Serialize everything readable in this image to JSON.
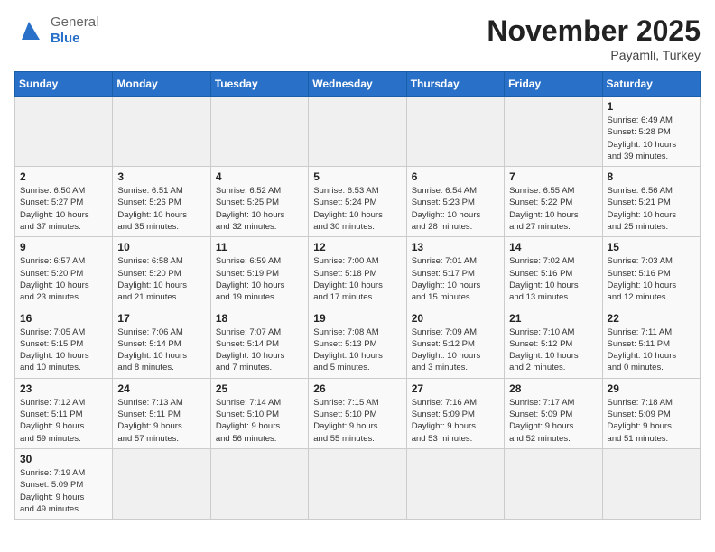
{
  "header": {
    "logo_general": "General",
    "logo_blue": "Blue",
    "month_title": "November 2025",
    "subtitle": "Payamli, Turkey"
  },
  "days_of_week": [
    "Sunday",
    "Monday",
    "Tuesday",
    "Wednesday",
    "Thursday",
    "Friday",
    "Saturday"
  ],
  "weeks": [
    [
      {
        "day": "",
        "info": ""
      },
      {
        "day": "",
        "info": ""
      },
      {
        "day": "",
        "info": ""
      },
      {
        "day": "",
        "info": ""
      },
      {
        "day": "",
        "info": ""
      },
      {
        "day": "",
        "info": ""
      },
      {
        "day": "1",
        "info": "Sunrise: 6:49 AM\nSunset: 5:28 PM\nDaylight: 10 hours\nand 39 minutes."
      }
    ],
    [
      {
        "day": "2",
        "info": "Sunrise: 6:50 AM\nSunset: 5:27 PM\nDaylight: 10 hours\nand 37 minutes."
      },
      {
        "day": "3",
        "info": "Sunrise: 6:51 AM\nSunset: 5:26 PM\nDaylight: 10 hours\nand 35 minutes."
      },
      {
        "day": "4",
        "info": "Sunrise: 6:52 AM\nSunset: 5:25 PM\nDaylight: 10 hours\nand 32 minutes."
      },
      {
        "day": "5",
        "info": "Sunrise: 6:53 AM\nSunset: 5:24 PM\nDaylight: 10 hours\nand 30 minutes."
      },
      {
        "day": "6",
        "info": "Sunrise: 6:54 AM\nSunset: 5:23 PM\nDaylight: 10 hours\nand 28 minutes."
      },
      {
        "day": "7",
        "info": "Sunrise: 6:55 AM\nSunset: 5:22 PM\nDaylight: 10 hours\nand 27 minutes."
      },
      {
        "day": "8",
        "info": "Sunrise: 6:56 AM\nSunset: 5:21 PM\nDaylight: 10 hours\nand 25 minutes."
      }
    ],
    [
      {
        "day": "9",
        "info": "Sunrise: 6:57 AM\nSunset: 5:20 PM\nDaylight: 10 hours\nand 23 minutes."
      },
      {
        "day": "10",
        "info": "Sunrise: 6:58 AM\nSunset: 5:20 PM\nDaylight: 10 hours\nand 21 minutes."
      },
      {
        "day": "11",
        "info": "Sunrise: 6:59 AM\nSunset: 5:19 PM\nDaylight: 10 hours\nand 19 minutes."
      },
      {
        "day": "12",
        "info": "Sunrise: 7:00 AM\nSunset: 5:18 PM\nDaylight: 10 hours\nand 17 minutes."
      },
      {
        "day": "13",
        "info": "Sunrise: 7:01 AM\nSunset: 5:17 PM\nDaylight: 10 hours\nand 15 minutes."
      },
      {
        "day": "14",
        "info": "Sunrise: 7:02 AM\nSunset: 5:16 PM\nDaylight: 10 hours\nand 13 minutes."
      },
      {
        "day": "15",
        "info": "Sunrise: 7:03 AM\nSunset: 5:16 PM\nDaylight: 10 hours\nand 12 minutes."
      }
    ],
    [
      {
        "day": "16",
        "info": "Sunrise: 7:05 AM\nSunset: 5:15 PM\nDaylight: 10 hours\nand 10 minutes."
      },
      {
        "day": "17",
        "info": "Sunrise: 7:06 AM\nSunset: 5:14 PM\nDaylight: 10 hours\nand 8 minutes."
      },
      {
        "day": "18",
        "info": "Sunrise: 7:07 AM\nSunset: 5:14 PM\nDaylight: 10 hours\nand 7 minutes."
      },
      {
        "day": "19",
        "info": "Sunrise: 7:08 AM\nSunset: 5:13 PM\nDaylight: 10 hours\nand 5 minutes."
      },
      {
        "day": "20",
        "info": "Sunrise: 7:09 AM\nSunset: 5:12 PM\nDaylight: 10 hours\nand 3 minutes."
      },
      {
        "day": "21",
        "info": "Sunrise: 7:10 AM\nSunset: 5:12 PM\nDaylight: 10 hours\nand 2 minutes."
      },
      {
        "day": "22",
        "info": "Sunrise: 7:11 AM\nSunset: 5:11 PM\nDaylight: 10 hours\nand 0 minutes."
      }
    ],
    [
      {
        "day": "23",
        "info": "Sunrise: 7:12 AM\nSunset: 5:11 PM\nDaylight: 9 hours\nand 59 minutes."
      },
      {
        "day": "24",
        "info": "Sunrise: 7:13 AM\nSunset: 5:11 PM\nDaylight: 9 hours\nand 57 minutes."
      },
      {
        "day": "25",
        "info": "Sunrise: 7:14 AM\nSunset: 5:10 PM\nDaylight: 9 hours\nand 56 minutes."
      },
      {
        "day": "26",
        "info": "Sunrise: 7:15 AM\nSunset: 5:10 PM\nDaylight: 9 hours\nand 55 minutes."
      },
      {
        "day": "27",
        "info": "Sunrise: 7:16 AM\nSunset: 5:09 PM\nDaylight: 9 hours\nand 53 minutes."
      },
      {
        "day": "28",
        "info": "Sunrise: 7:17 AM\nSunset: 5:09 PM\nDaylight: 9 hours\nand 52 minutes."
      },
      {
        "day": "29",
        "info": "Sunrise: 7:18 AM\nSunset: 5:09 PM\nDaylight: 9 hours\nand 51 minutes."
      }
    ],
    [
      {
        "day": "30",
        "info": "Sunrise: 7:19 AM\nSunset: 5:09 PM\nDaylight: 9 hours\nand 49 minutes."
      },
      {
        "day": "",
        "info": ""
      },
      {
        "day": "",
        "info": ""
      },
      {
        "day": "",
        "info": ""
      },
      {
        "day": "",
        "info": ""
      },
      {
        "day": "",
        "info": ""
      },
      {
        "day": "",
        "info": ""
      }
    ]
  ]
}
